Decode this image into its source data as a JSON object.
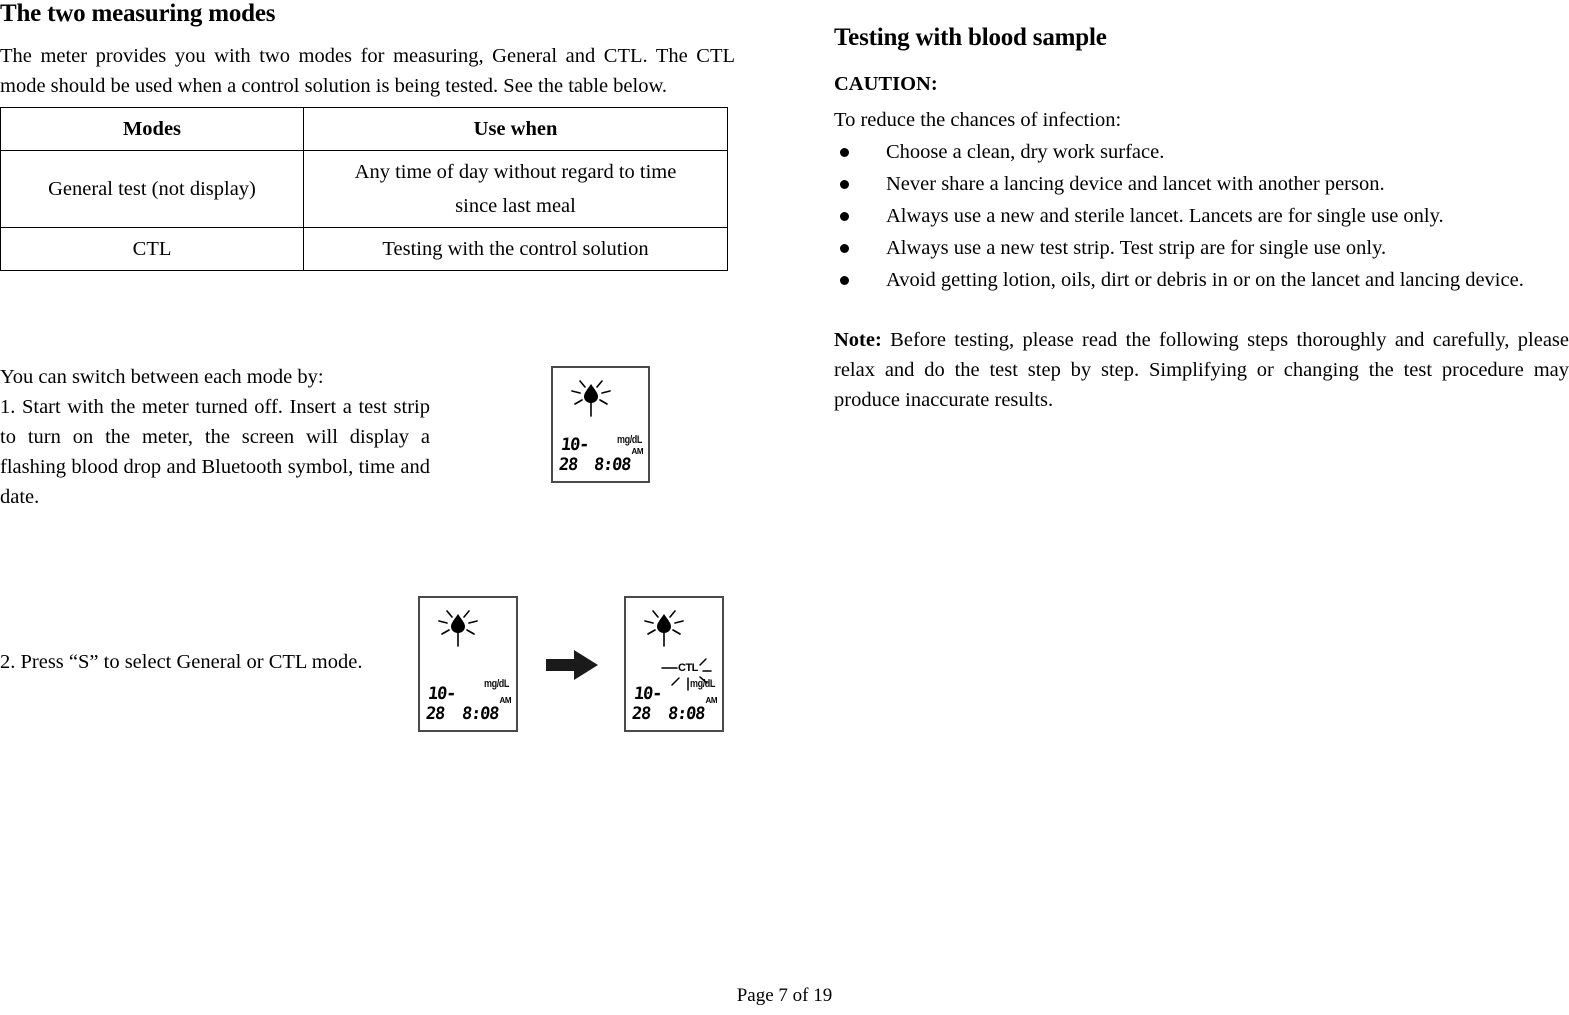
{
  "document": {
    "footer": "Page 7 of 19"
  },
  "left_column": {
    "title": "The two measuring modes",
    "intro": "The meter provides you with two modes for measuring, General and CTL. The CTL mode should be used when a control solution is being tested. See the table below.",
    "table": {
      "headers": [
        "Modes",
        "Use when"
      ],
      "rows": [
        {
          "mode": "General test (not display)",
          "use_when_line1": "Any time of day without regard to time",
          "use_when_line2": "since last meal"
        },
        {
          "mode": "CTL",
          "use_when_line1": "Testing with the control solution",
          "use_when_line2": ""
        }
      ]
    },
    "switch_intro": "You can switch between each mode by:",
    "step1": "1. Start with the meter turned off. Insert a test strip to turn on the meter, the screen will display a flashing blood drop and Bluetooth symbol, time and date.",
    "step2": "2. Press “S” to select General or CTL mode."
  },
  "lcd_displays": {
    "display1": {
      "unit": "mg/dL",
      "date": "10-28",
      "time": "8:08",
      "ampm": "AM",
      "icon": "flashing-blood-drop"
    },
    "display2": {
      "unit": "mg/dL",
      "date": "10-28",
      "time": "8:08",
      "ampm": "AM",
      "icon": "flashing-blood-drop"
    },
    "display3": {
      "unit": "mg/dL",
      "ctl_label": "CTL",
      "date": "10-28",
      "time": "8:08",
      "ampm": "AM",
      "icon": "flashing-blood-drop"
    }
  },
  "right_column": {
    "title": "Testing with blood sample",
    "caution_label": "CAUTION:",
    "caution_lead": "To reduce the chances of infection:",
    "bullets": [
      "Choose a clean, dry work surface.",
      "Never share a lancing device and lancet with another person.",
      "Always use a new and sterile lancet. Lancets are for single use only.",
      "Always use a new test strip. Test strip are for single use only.",
      "Avoid getting lotion, oils, dirt or debris in or on the lancet and lancing device."
    ],
    "note_label": "Note:",
    "note_text": " Before testing, please read the following steps thoroughly and carefully, please relax and do the test step by step. Simplifying or changing the test procedure may produce inaccurate results."
  }
}
